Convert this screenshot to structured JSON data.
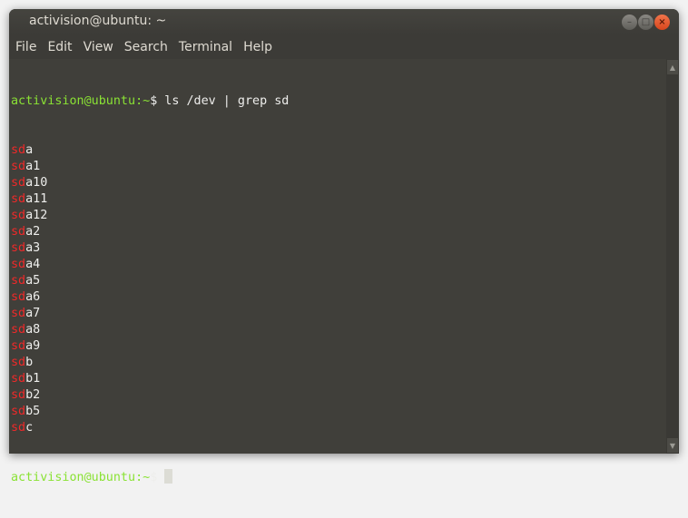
{
  "window": {
    "title": "activision@ubuntu: ~",
    "controls": {
      "minimize": "–",
      "maximize": "□",
      "close": "×"
    }
  },
  "menubar": [
    "File",
    "Edit",
    "View",
    "Search",
    "Terminal",
    "Help"
  ],
  "terminal": {
    "prompt_user_host": "activision@ubuntu",
    "prompt_path": ":~",
    "prompt_symbol": "$",
    "command": " ls /dev | grep sd",
    "match": "sd",
    "output_suffixes": [
      "a",
      "a1",
      "a10",
      "a11",
      "a12",
      "a2",
      "a3",
      "a4",
      "a5",
      "a6",
      "a7",
      "a8",
      "a9",
      "b",
      "b1",
      "b2",
      "b5",
      "c"
    ]
  },
  "scrollbar": {
    "up_icon": "▲",
    "down_icon": "▼"
  },
  "colors": {
    "prompt": "#8ae234",
    "match": "#ef2929",
    "text": "#eeeeec",
    "background": "#403f3a"
  }
}
